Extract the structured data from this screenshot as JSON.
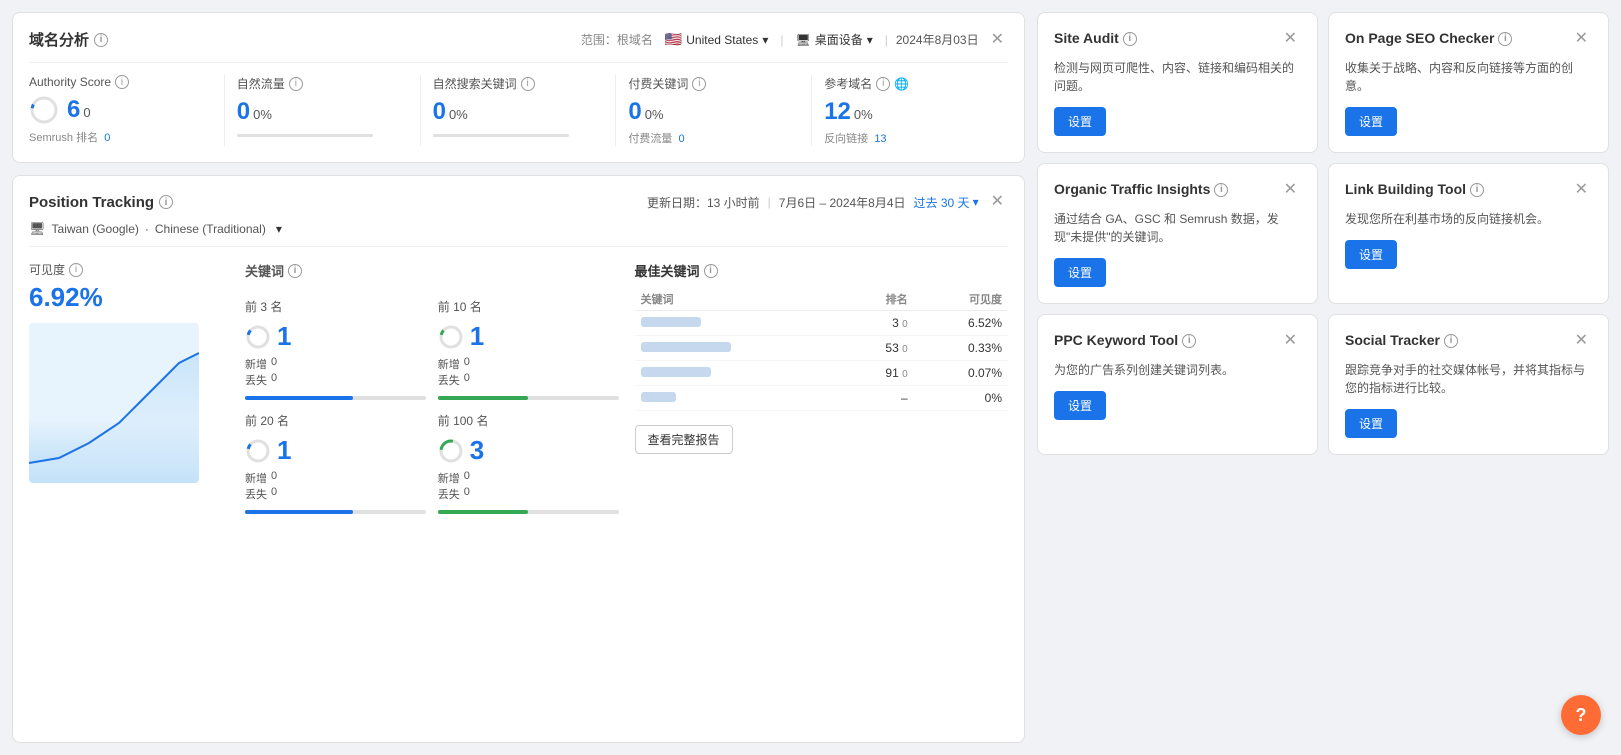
{
  "domain_analysis": {
    "title": "域名分析",
    "range_label": "范围：根域名",
    "country": "United States",
    "device": "桌面设备",
    "date": "2024年8月03日",
    "metrics": [
      {
        "label": "Authority Score",
        "value": "6",
        "sub_value": "0",
        "extra": "Semrush 排名  0",
        "has_chart": false,
        "type": "authority"
      },
      {
        "label": "自然流量",
        "value": "0",
        "percent": "0%",
        "has_chart": true,
        "type": "traffic"
      },
      {
        "label": "自然搜索关键词",
        "value": "0",
        "percent": "0%",
        "has_chart": true,
        "type": "keywords"
      },
      {
        "label": "付费关键词",
        "value": "0",
        "percent": "0%",
        "extra": "付费流量  0",
        "has_chart": false,
        "type": "paid"
      },
      {
        "label": "参考域名",
        "value": "12",
        "percent": "0%",
        "extra": "反向链接  13",
        "has_chart": false,
        "type": "backlinks"
      }
    ]
  },
  "position_tracking": {
    "title": "Position Tracking",
    "update_label": "更新日期：13 小时前",
    "date_range": "7月6日 – 2024年8月4日",
    "period_label": "过去 30 天",
    "location": "Taiwan (Google)",
    "language": "Chinese (Traditional)",
    "visibility": {
      "label": "可见度",
      "value": "6.92%"
    },
    "keywords": {
      "label": "关键词",
      "groups": [
        {
          "title": "前 3 名",
          "count": "1",
          "new": "0",
          "lost": "0",
          "color": "blue"
        },
        {
          "title": "前 10 名",
          "count": "1",
          "new": "0",
          "lost": "0",
          "color": "green"
        },
        {
          "title": "前 20 名",
          "count": "1",
          "new": "0",
          "lost": "0",
          "color": "blue"
        },
        {
          "title": "前 100 名",
          "count": "3",
          "new": "0",
          "lost": "0",
          "color": "green"
        }
      ]
    },
    "best_keywords": {
      "title": "最佳关键词",
      "col_keyword": "关键词",
      "col_rank": "排名",
      "col_visibility": "可见度",
      "rows": [
        {
          "keyword_width": 60,
          "rank": "3",
          "rank_change": "0",
          "visibility": "6.52%"
        },
        {
          "keyword_width": 90,
          "rank": "53",
          "rank_change": "0",
          "visibility": "0.33%"
        },
        {
          "keyword_width": 70,
          "rank": "91",
          "rank_change": "0",
          "visibility": "0.07%"
        },
        {
          "keyword_width": 35,
          "rank": "–",
          "rank_change": "",
          "visibility": "0%"
        }
      ]
    },
    "view_report_btn": "查看完整报告"
  },
  "site_audit": {
    "title": "Site Audit",
    "desc": "检测与网页可爬性、内容、链接和编码相关的问题。",
    "btn": "设置"
  },
  "on_page_seo": {
    "title": "On Page SEO Checker",
    "desc": "收集关于战略、内容和反向链接等方面的创意。",
    "btn": "设置"
  },
  "organic_traffic": {
    "title": "Organic Traffic Insights",
    "desc": "通过结合 GA、GSC 和 Semrush 数据，发现\"未提供\"的关键词。",
    "btn": "设置"
  },
  "link_building": {
    "title": "Link Building Tool",
    "desc": "发现您所在利基市场的反向链接机会。",
    "btn": "设置"
  },
  "ppc_keyword": {
    "title": "PPC Keyword Tool",
    "desc": "为您的广告系列创建关键词列表。",
    "btn": "设置"
  },
  "social_tracker": {
    "title": "Social Tracker",
    "desc": "跟踪竞争对手的社交媒体帐号，并将其指标与您的指标进行比较。",
    "btn": "设置"
  },
  "help_btn": "?"
}
